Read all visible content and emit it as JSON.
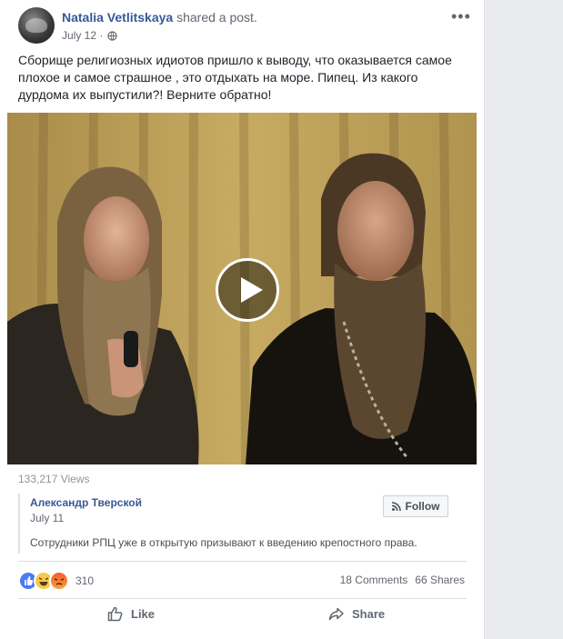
{
  "post": {
    "author": "Natalia Vetlitskaya",
    "action": "shared a post.",
    "date": "July 12 · ",
    "text": "Сборище религиозных идиотов пришло к выводу, что оказывается самое плохое и самое страшное , это отдыхать на море. Пипец. Из какого дурдома их выпустили?! Верните обратно!",
    "views": "133,217 Views"
  },
  "shared": {
    "author": "Александр Тверской",
    "date": "July 11",
    "follow_label": "Follow",
    "text": "Сотрудники РПЦ уже в открытую призывают к введению крепостного права."
  },
  "stats": {
    "reactions_count": "310",
    "comments": "18 Comments",
    "shares": "66 Shares",
    "reactions": [
      "like",
      "haha",
      "angry"
    ]
  },
  "actions": {
    "like_label": "Like",
    "share_label": "Share"
  },
  "colors": {
    "link": "#385898",
    "secondary": "#616770",
    "like": "#4a7bf3"
  }
}
